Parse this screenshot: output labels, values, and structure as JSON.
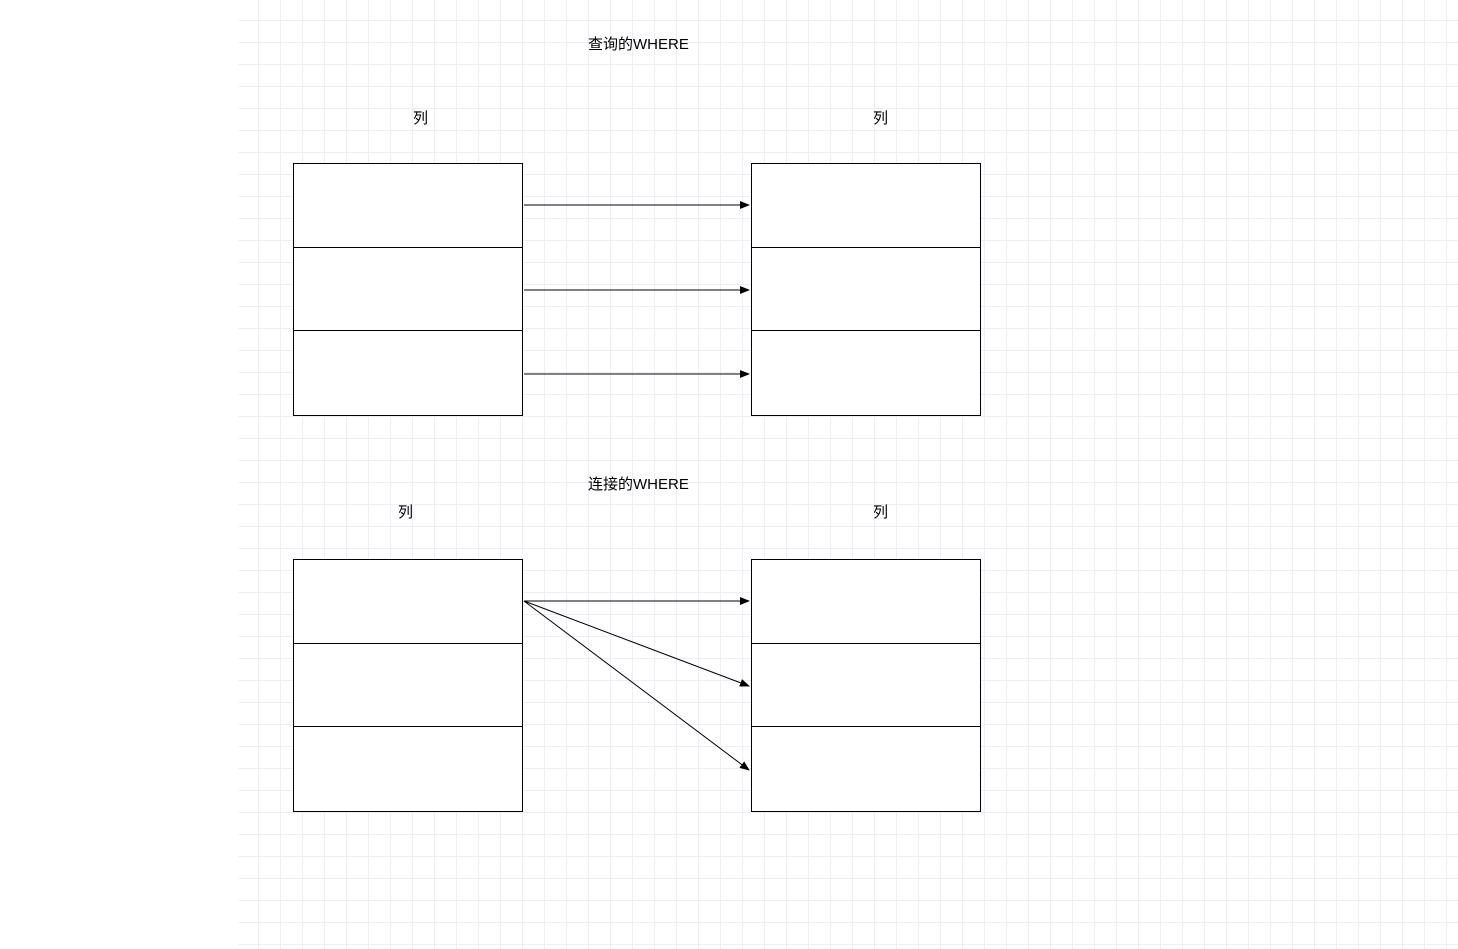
{
  "diagram1": {
    "title": "查询的WHERE",
    "left_label": "列",
    "right_label": "列"
  },
  "diagram2": {
    "title": "连接的WHERE",
    "left_label": "列",
    "right_label": "列"
  }
}
